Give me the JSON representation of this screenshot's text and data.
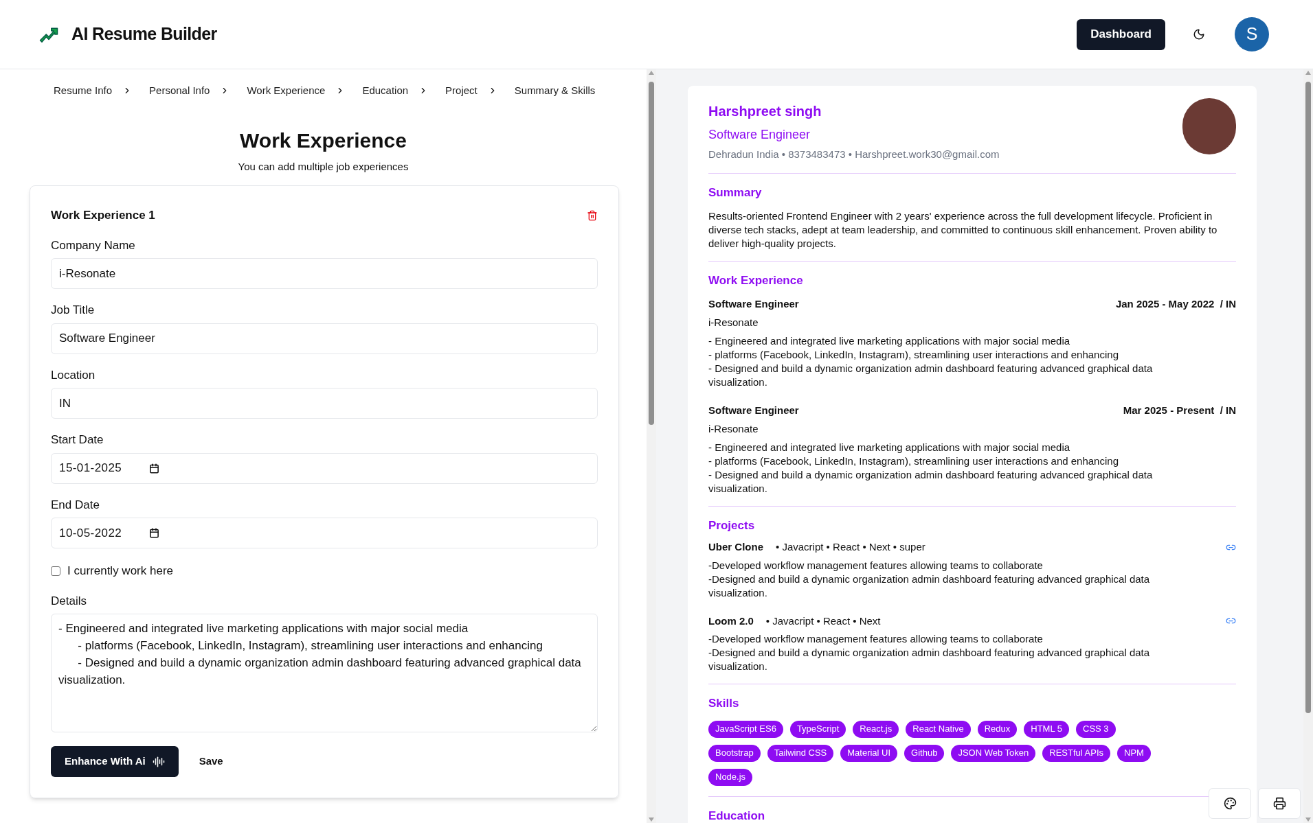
{
  "header": {
    "title": "AI Resume Builder",
    "dashboard_button": "Dashboard",
    "avatar_letter": "S"
  },
  "breadcrumbs": [
    "Resume Info",
    "Personal Info",
    "Work Experience",
    "Education",
    "Project",
    "Summary & Skills"
  ],
  "form": {
    "title": "Work Experience",
    "subtitle": "You can add multiple job experiences",
    "card_title": "Work Experience 1",
    "fields": [
      {
        "kind": "text",
        "label": "Company Name",
        "value": "i-Resonate"
      },
      {
        "kind": "text",
        "label": "Job Title",
        "value": "Software Engineer"
      },
      {
        "kind": "text",
        "label": "Location",
        "value": "IN"
      },
      {
        "kind": "date",
        "label": "Start Date",
        "value": "15-01-2025"
      },
      {
        "kind": "date",
        "label": "End Date",
        "value": "10-05-2022"
      }
    ],
    "current_job": {
      "label": "I currently work here",
      "checked": false
    },
    "details_label": "Details",
    "details": "- Engineered and integrated live marketing applications with major social media\n      - platforms (Facebook, LinkedIn, Instagram), streamlining user interactions and enhancing\n      - Designed and build a dynamic organization admin dashboard featuring advanced graphical data visualization.",
    "enhance_button": "Enhance With Ai",
    "save_button": "Save"
  },
  "preview": {
    "name": "Harshpreet singh",
    "job_title": "Software Engineer",
    "contact": "Dehradun India • 8373483473 • Harshpreet.work30@gmail.com",
    "summary_heading": "Summary",
    "summary": "Results-oriented Frontend Engineer with 2 years' experience across the full development lifecycle. Proficient in diverse tech stacks, adept at team leadership, and committed to continuous skill enhancement. Proven ability to deliver high-quality projects.",
    "work_heading": "Work Experience",
    "jobs": [
      {
        "title": "Software Engineer",
        "dates": "Jan 2025 - May 2022  / IN",
        "company": "i-Resonate",
        "lines": [
          "- Engineered and integrated live marketing applications with major social media",
          "- platforms (Facebook, LinkedIn, Instagram), streamlining user interactions and enhancing",
          "- Designed and build a dynamic organization admin dashboard featuring advanced graphical data visualization."
        ]
      },
      {
        "title": "Software Engineer",
        "dates": "Mar 2025 - Present  / IN",
        "company": "i-Resonate",
        "lines": [
          "- Engineered and integrated live marketing applications with major social media",
          "- platforms (Facebook, LinkedIn, Instagram), streamlining user interactions and enhancing",
          "- Designed and build a dynamic organization admin dashboard featuring advanced graphical data visualization."
        ]
      }
    ],
    "projects_heading": "Projects",
    "projects": [
      {
        "name": "Uber Clone",
        "tech": "• Javacript • React • Next • super",
        "lines": [
          "-Developed workflow management features allowing teams to collaborate",
          "-Designed and build a dynamic organization admin dashboard featuring advanced graphical data visualization."
        ]
      },
      {
        "name": "Loom 2.0",
        "tech": "• Javacript • React • Next",
        "lines": [
          "-Developed workflow management features allowing teams to collaborate",
          "-Designed and build a dynamic organization admin dashboard featuring advanced graphical data visualization."
        ]
      }
    ],
    "skills_heading": "Skills",
    "skills": [
      "JavaScript ES6",
      "TypeScript",
      "React.js",
      "React Native",
      "Redux",
      "HTML 5",
      "CSS 3",
      "Bootstrap",
      "Tailwind CSS",
      "Material UI",
      "Github",
      "JSON Web Token",
      "RESTful APIs",
      "NPM",
      "Node.js"
    ],
    "education_heading": "Education"
  }
}
